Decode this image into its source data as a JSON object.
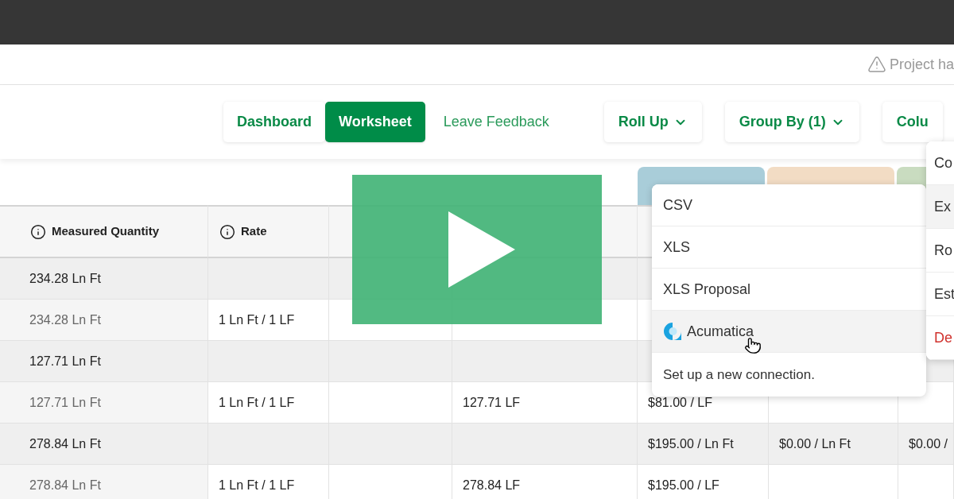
{
  "notice": {
    "text": "Project ha"
  },
  "views": [
    {
      "label": "Dashboard",
      "selected": false
    },
    {
      "label": "Worksheet",
      "selected": true
    }
  ],
  "feedback_link": "Leave Feedback",
  "toolbar_dropdowns": [
    {
      "label": "Roll Up",
      "chevron": true
    },
    {
      "label": "Group By (1)",
      "chevron": true
    },
    {
      "label": "Colu",
      "chevron": false
    }
  ],
  "category_tabs": [
    {
      "color": "#a9cdd9"
    },
    {
      "color": "#f2dcc4"
    },
    {
      "color": "#c9dcc0"
    }
  ],
  "table": {
    "columns": [
      null,
      "Measured Quantity",
      "Rate",
      null,
      null,
      null,
      null,
      null
    ],
    "rows": [
      {
        "kind": "group",
        "cells": [
          null,
          "234.28 Ln Ft",
          null,
          null,
          null,
          null,
          null,
          null
        ]
      },
      {
        "kind": "item",
        "cells": [
          null,
          "234.28 Ln Ft",
          "1 Ln Ft / 1 LF",
          null,
          null,
          null,
          null,
          null
        ]
      },
      {
        "kind": "group",
        "cells": [
          null,
          "127.71 Ln Ft",
          null,
          null,
          null,
          null,
          null,
          null
        ]
      },
      {
        "kind": "item",
        "cells": [
          null,
          "127.71 Ln Ft",
          "1 Ln Ft / 1 LF",
          null,
          "127.71 LF",
          "$81.00 / LF",
          null,
          null
        ]
      },
      {
        "kind": "group",
        "cells": [
          null,
          "278.84 Ln Ft",
          null,
          null,
          null,
          "$195.00 / Ln Ft",
          "$0.00 / Ln Ft",
          "$0.00 /"
        ]
      },
      {
        "kind": "item",
        "cells": [
          null,
          "278.84 Ln Ft",
          "1 Ln Ft / 1 LF",
          null,
          "278.84 LF",
          "$195.00 / LF",
          null,
          null
        ]
      }
    ]
  },
  "export_menu": {
    "items": [
      {
        "label": "CSV",
        "kind": "format",
        "selected": false
      },
      {
        "label": "XLS",
        "kind": "format",
        "selected": false
      },
      {
        "label": "XLS Proposal",
        "kind": "format",
        "selected": false
      },
      {
        "label": "Acumatica",
        "kind": "integration",
        "selected": true
      }
    ],
    "footer": "Set up a new connection."
  },
  "side_menu": {
    "items": [
      {
        "label": "Co",
        "kind": "normal",
        "selected": false
      },
      {
        "label": "Ex",
        "kind": "normal",
        "selected": true
      },
      {
        "label": "Ro",
        "kind": "normal",
        "selected": false
      },
      {
        "label": "Est",
        "kind": "normal",
        "selected": false
      },
      {
        "label": "De",
        "kind": "danger",
        "selected": false
      }
    ]
  }
}
